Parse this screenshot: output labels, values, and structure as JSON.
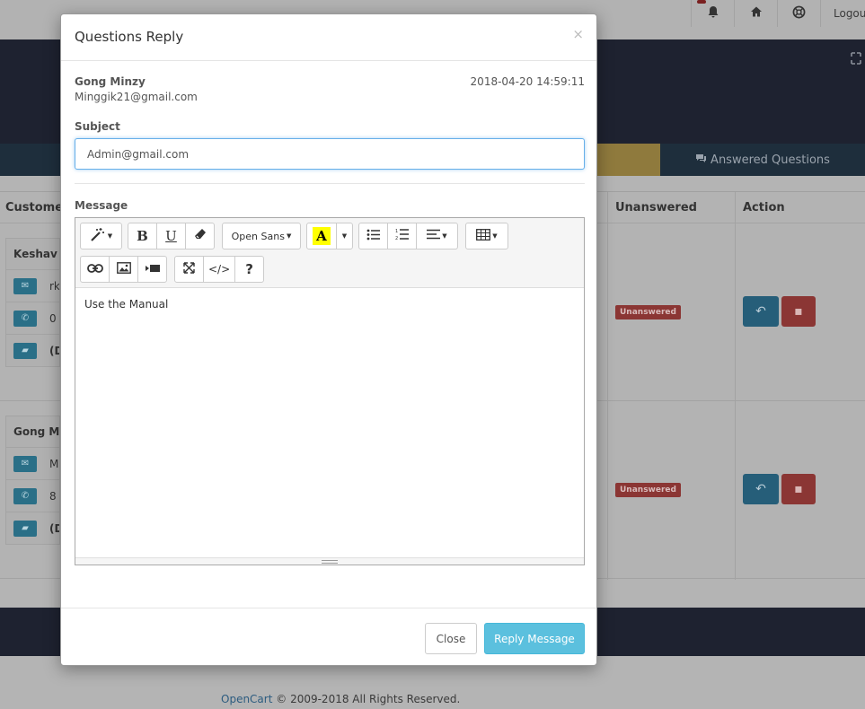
{
  "background": {
    "topbar": {
      "logout_label": "Logou"
    },
    "tabs": {
      "answered_label": "Answered Questions"
    },
    "table": {
      "headers": {
        "customer": "Customer",
        "unanswered": "Unanswered",
        "action": "Action"
      },
      "rows": [
        {
          "name": "Keshav R",
          "email_short": "rk",
          "phone_short": "0",
          "other_short": "(D",
          "status": "Unanswered"
        },
        {
          "name": "Gong Mi",
          "email_short": "M",
          "phone_short": "8",
          "other_short": "(D",
          "status": "Unanswered"
        }
      ]
    },
    "footer": {
      "brand": "OpenCart",
      "copyright": "© 2009-2018 All Rights Reserved."
    }
  },
  "modal": {
    "title": "Questions Reply",
    "close_symbol": "×",
    "sender": {
      "name": "Gong Minzy",
      "email": "Minggik21@gmail.com",
      "date": "2018-04-20 14:59:11"
    },
    "subject": {
      "label": "Subject",
      "value": "Admin@gmail.com"
    },
    "message": {
      "label": "Message",
      "content": "Use the Manual"
    },
    "toolbar": {
      "font_name": "Open Sans",
      "bold": "B",
      "underline": "U",
      "color_letter": "A",
      "code": "</>",
      "help": "?"
    },
    "buttons": {
      "close": "Close",
      "reply": "Reply Message"
    }
  }
}
